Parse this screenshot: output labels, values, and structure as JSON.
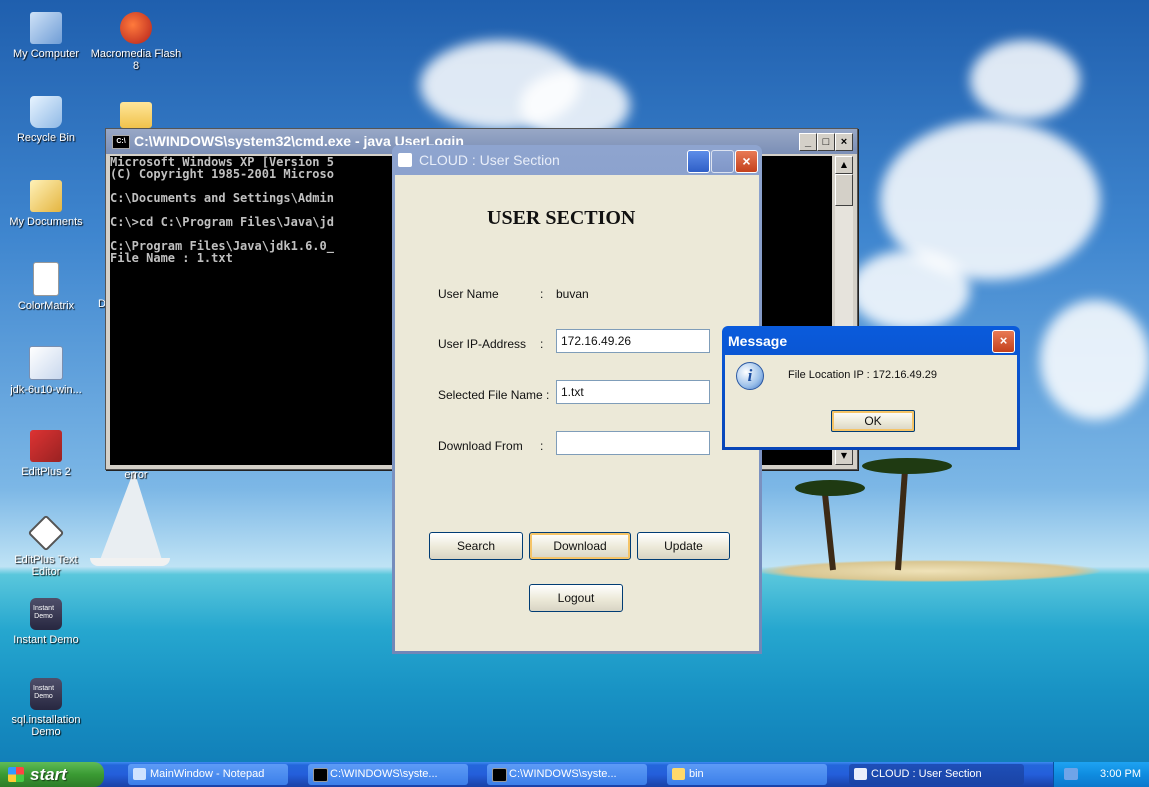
{
  "desktop": {
    "icons": [
      {
        "label": "My Computer"
      },
      {
        "label": "Macromedia Flash 8"
      },
      {
        "label": "Recycle Bin"
      },
      {
        "label": ""
      },
      {
        "label": "My Documents"
      },
      {
        "label": "ColorMatrix"
      },
      {
        "label": "jdk-6u10-win..."
      },
      {
        "label": "EditPlus 2"
      },
      {
        "label": "error"
      },
      {
        "label": "EditPlus Text Editor"
      },
      {
        "label": "Instant Demo"
      },
      {
        "label": "sql.installation Demo"
      }
    ],
    "partial_label": "D"
  },
  "cmd": {
    "title": "C:\\WINDOWS\\system32\\cmd.exe - java UserLogin",
    "icon_text": "C:\\",
    "lines": [
      "Microsoft Windows XP [Version 5",
      "(C) Copyright 1985-2001 Microso",
      "",
      "C:\\Documents and Settings\\Admin",
      "",
      "C:\\>cd C:\\Program Files\\Java\\jd",
      "",
      "C:\\Program Files\\Java\\jdk1.6.0_",
      "File Name : 1.txt"
    ],
    "buttons": {
      "minimize": "_",
      "maximize": "□",
      "close": "×"
    }
  },
  "cloud_window": {
    "title": "CLOUD : User Section",
    "heading": "USER SECTION",
    "user_name_label": "User Name",
    "user_name_sep": ":",
    "user_name_value": "buvan",
    "ip_label": "User IP-Address",
    "ip_sep": ":",
    "ip_value": "172.16.49.26",
    "file_label": "Selected File Name :",
    "file_value": "1.txt",
    "download_from_label": "Download From",
    "download_from_sep": ":",
    "download_from_value": "",
    "buttons": {
      "search": "Search",
      "download": "Download",
      "update": "Update",
      "logout": "Logout"
    }
  },
  "message": {
    "title": "Message",
    "text": "File Location IP : 172.16.49.29",
    "ok": "OK",
    "close": "×",
    "info_glyph": "i"
  },
  "taskbar": {
    "start": "start",
    "items": [
      {
        "label": "MainWindow - Notepad"
      },
      {
        "label": "C:\\WINDOWS\\syste..."
      },
      {
        "label": "C:\\WINDOWS\\syste..."
      },
      {
        "label": "bin"
      },
      {
        "label": "CLOUD : User Section"
      }
    ],
    "clock": "3:00 PM"
  },
  "colors": {
    "xp_blue": "#0846b8",
    "window_face": "#ece9d8",
    "cmd_bg": "#000000",
    "start_green": "#3a9a33"
  }
}
